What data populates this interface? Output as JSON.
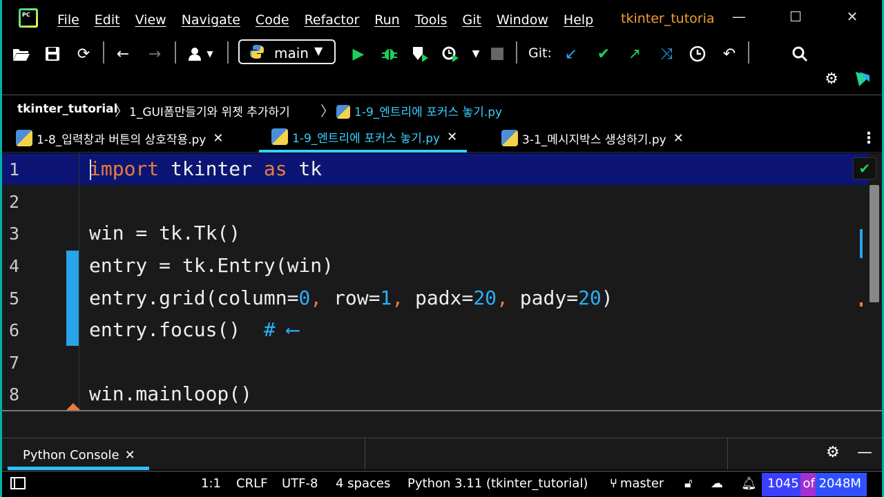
{
  "app": {
    "window_title": "tkinter_tutoria",
    "logo_text": "PC"
  },
  "menu": [
    "File",
    "Edit",
    "View",
    "Navigate",
    "Code",
    "Refactor",
    "Run",
    "Tools",
    "Git",
    "Window",
    "Help"
  ],
  "toolbar": {
    "branch": "main",
    "git_label": "Git:"
  },
  "breadcrumb": {
    "project": "tkinter_tutorial",
    "folder": "1_GUI폼만들기와 위젯 추가하기",
    "file": "1-9_엔트리에 포커스 놓기.py"
  },
  "tabs": [
    {
      "label": "1-8_입력창과 버튼의 상호작용.py",
      "active": false
    },
    {
      "label": "1-9_엔트리에 포커스 놓기.py",
      "active": true
    },
    {
      "label": "3-1_메시지박스 생성하기.py",
      "active": false
    }
  ],
  "editor": {
    "line_numbers": [
      "1",
      "2",
      "3",
      "4",
      "5",
      "6",
      "7",
      "8"
    ],
    "lines": {
      "l1": {
        "kw1": "import",
        "t1": " tkinter ",
        "kw2": "as",
        "t2": " tk"
      },
      "l3": {
        "t1": "win = tk.Tk()"
      },
      "l4": {
        "t1": "entry = tk.Entry(win)"
      },
      "l5": {
        "t1": "entry.grid(column=",
        "n1": "0",
        "c1": ",",
        "t2": " row=",
        "n2": "1",
        "c2": ",",
        "t3": " padx=",
        "n3": "20",
        "c3": ",",
        "t4": " pady=",
        "n4": "20",
        "t5": ")"
      },
      "l6": {
        "t1": "entry.focus()  ",
        "cmt": "# ⟵"
      },
      "l8": {
        "t1": "win.mainloop()"
      }
    },
    "close_glyph": "✕"
  },
  "toolwindow": {
    "tab_label": "Python Console"
  },
  "statusbar": {
    "position": "1:1",
    "line_sep": "CRLF",
    "encoding": "UTF-8",
    "indent": "4 spaces",
    "interpreter": "Python 3.11 (tkinter_tutorial)",
    "vcs_branch": "master",
    "memory": "1045 of 2048M",
    "memory_used_fraction": 0.51
  },
  "colors": {
    "accent": "#30c0ff",
    "keyword": "#e87d3e",
    "number": "#28b0ff",
    "title": "#f0a030"
  }
}
